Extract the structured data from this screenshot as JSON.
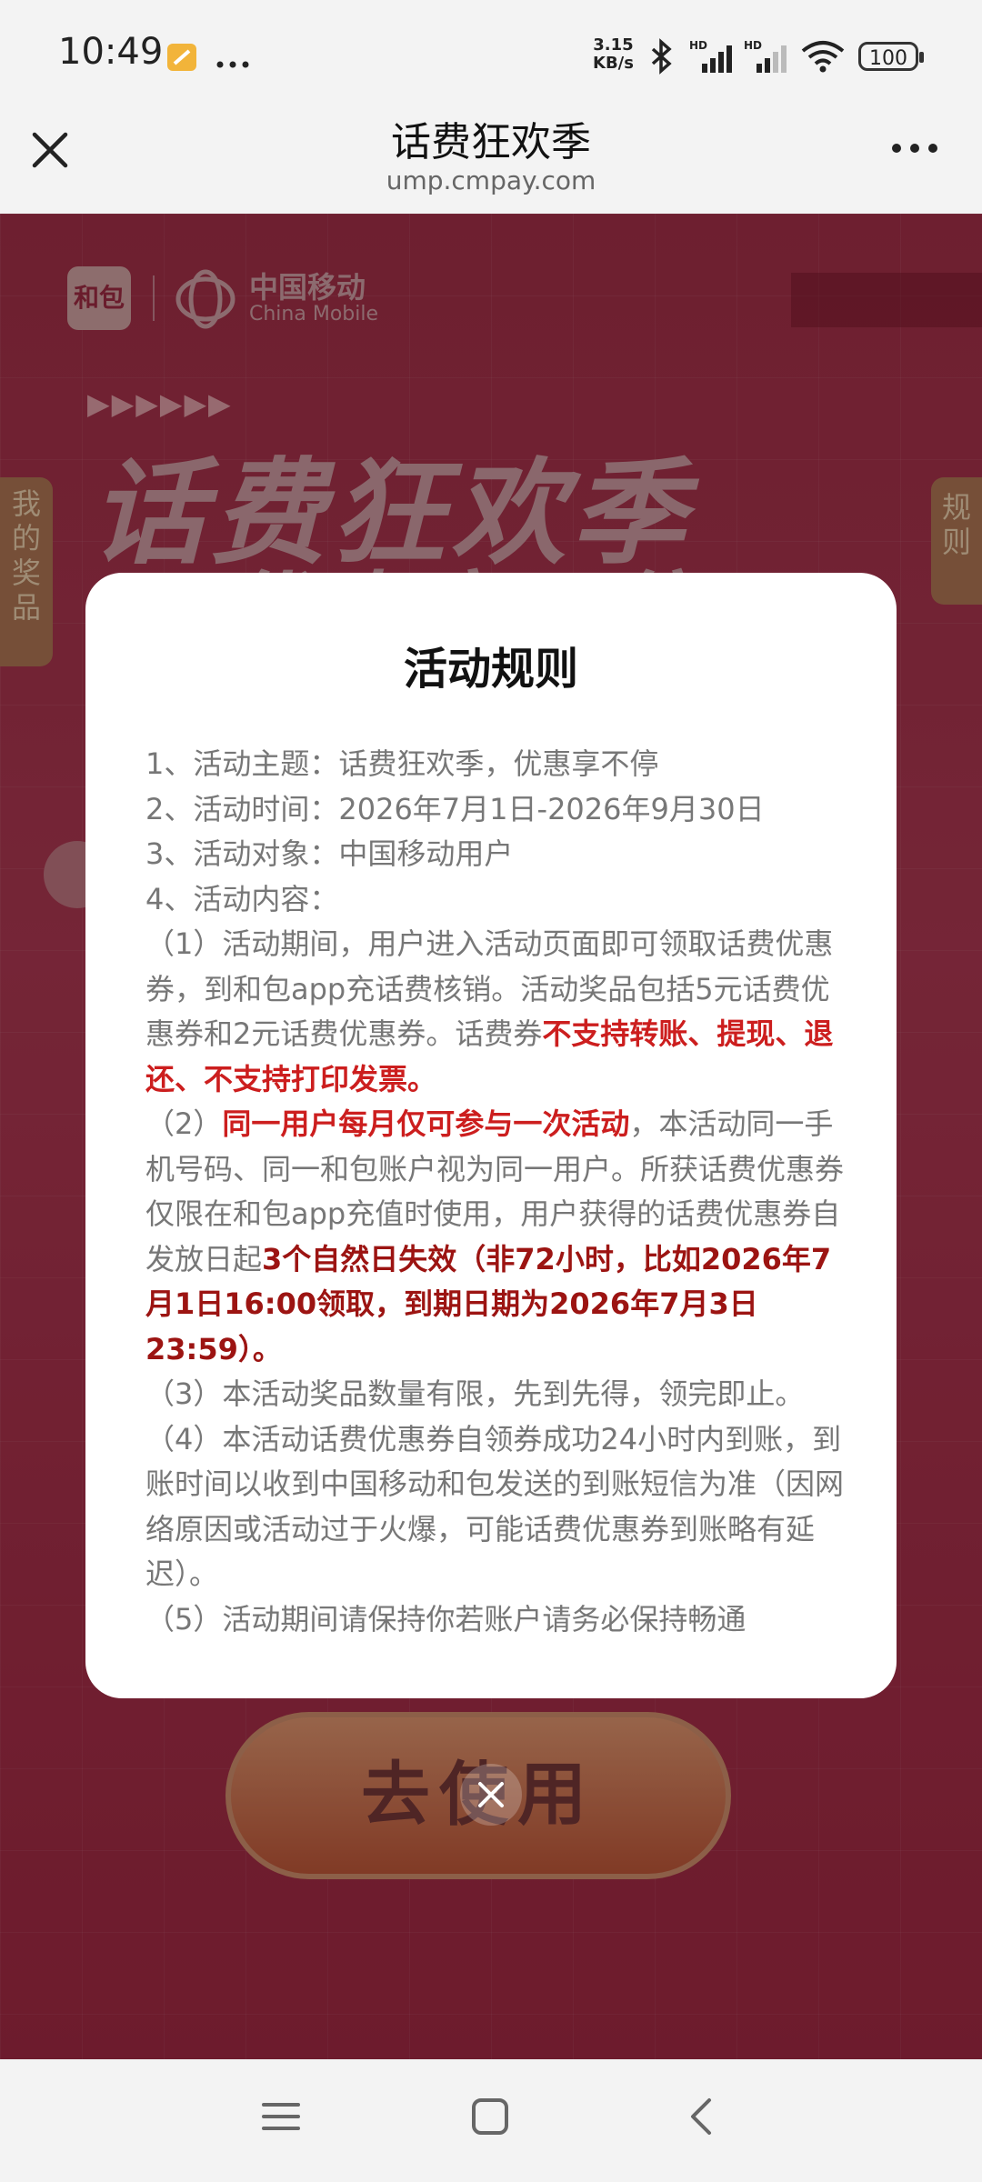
{
  "status_bar": {
    "time": "10:49",
    "net_speed_value": "3.15",
    "net_speed_unit": "KB/s",
    "battery": "100",
    "icons": [
      "notification-icon",
      "more-dots-icon",
      "bluetooth-icon",
      "signal-hd-1-icon",
      "signal-hd-2-icon",
      "wifi-icon",
      "battery-icon"
    ]
  },
  "browser": {
    "title": "话费狂欢季",
    "url": "ump.cmpay.com"
  },
  "background": {
    "logo_hebao": "和包",
    "logo_cm_cn": "中国移动",
    "logo_cm_en": "China Mobile",
    "arrows": "▶▶▶▶▶▶",
    "headline": "话费狂欢季",
    "subline": "优惠享不停",
    "side_left": "我的奖品",
    "side_right": "规则",
    "use_button": "去使用"
  },
  "modal": {
    "title": "活动规则",
    "p1": "1、活动主题：话费狂欢季，优惠享不停",
    "p2": "2、活动时间：2026年7月1日-2026年9月30日",
    "p3": "3、活动对象：中国移动用户",
    "p4": "4、活动内容：",
    "p5_a": "（1）活动期间，用户进入活动页面即可领取话费优惠券，到和包app充话费核销。活动奖品包括5元话费优惠券和2元话费优惠券。话费券",
    "p5_b": "不支持转账、提现、退还、不支持打印发票。",
    "p6_a": "（2）",
    "p6_b": "同一用户每月仅可参与一次活动",
    "p6_c": "，本活动同一手机号码、同一和包账户视为同一用户。所获话费优惠券仅限在和包app充值时使用，用户获得的话费优惠券自发放日起",
    "p6_d": "3个自然日失效（非72小时，比如2026年7月1日16:00领取，到期日期为2026年7月3日23:59）。",
    "p7": "（3）本活动奖品数量有限，先到先得，领完即止。",
    "p8": "（4）本活动话费优惠券自领券成功24小时内到账，到账时间以收到中国移动和包发送的到账短信为准（因网络原因或活动过于火爆，可能话费优惠券到账略有延迟）。",
    "p9": "（5）活动期间请保持你若账户请务必保持畅通"
  },
  "colors": {
    "accent_red": "#cc1e1e",
    "dark_red": "#9c1412",
    "bg_red": "#a9314a"
  }
}
